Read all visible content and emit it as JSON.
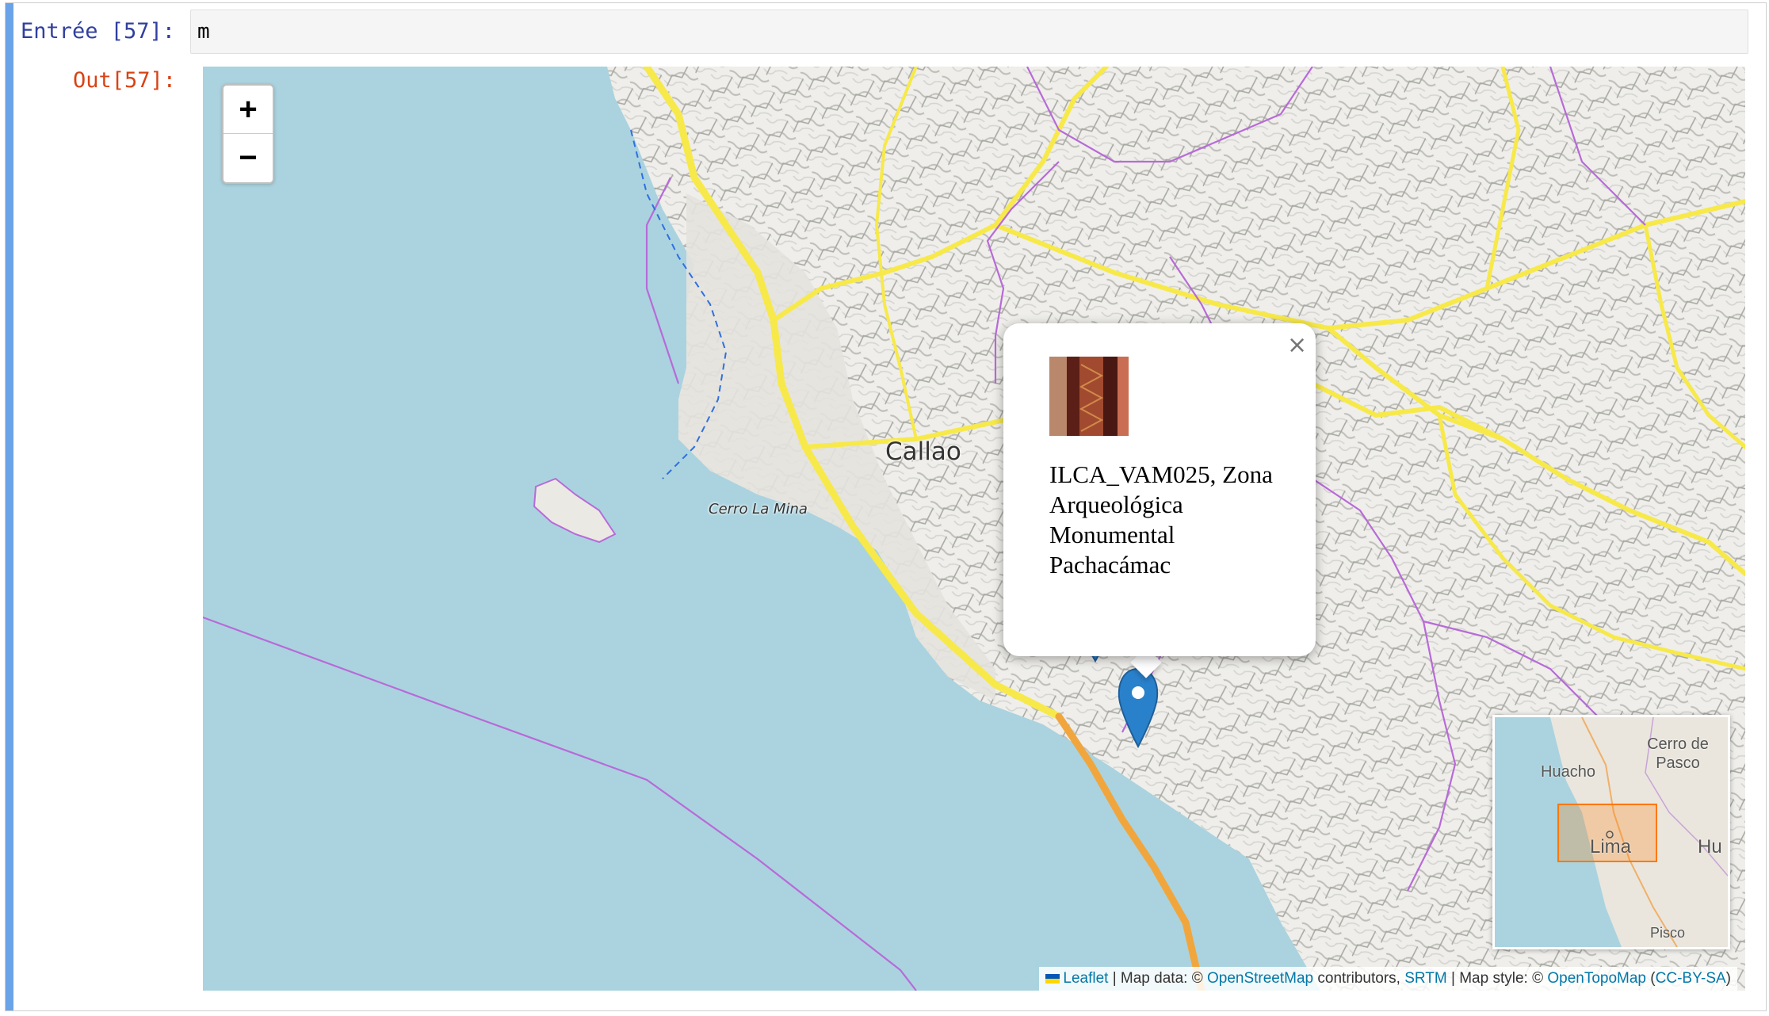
{
  "cell": {
    "in_prompt": "Entrée [57]:",
    "out_prompt": "Out[57]:",
    "input_code": "m"
  },
  "map": {
    "zoom_in": "+",
    "zoom_out": "−",
    "labels": {
      "callao": "Callao",
      "cerro_la_mina": "Cerro La Mina"
    },
    "popup": {
      "close": "×",
      "title": "ILCA_VAM025, Zona Arqueológica Monumental Pachacámac",
      "thumbnail_icon": "textile-photo"
    },
    "minimap": {
      "labels": {
        "cerro_de_pasco": "Cerro de Pasco",
        "huacho": "Huacho",
        "lima": "Lima",
        "hu": "Hu",
        "pisco": "Pisco"
      }
    },
    "attribution": {
      "leaflet": "Leaflet",
      "sep1": " | Map data: © ",
      "osm": "OpenStreetMap",
      "contributors": " contributors, ",
      "srtm": "SRTM",
      "sep2": " | Map style: © ",
      "opentopomap": "OpenTopoMap",
      "open_paren": " (",
      "ccbysa": "CC-BY-SA",
      "close_paren": ")"
    },
    "colors": {
      "water": "#aad3df",
      "land": "#ecebe6",
      "road": "#f7e94a",
      "boundary": "#b86ad8",
      "marker": "#2a81cb"
    }
  }
}
